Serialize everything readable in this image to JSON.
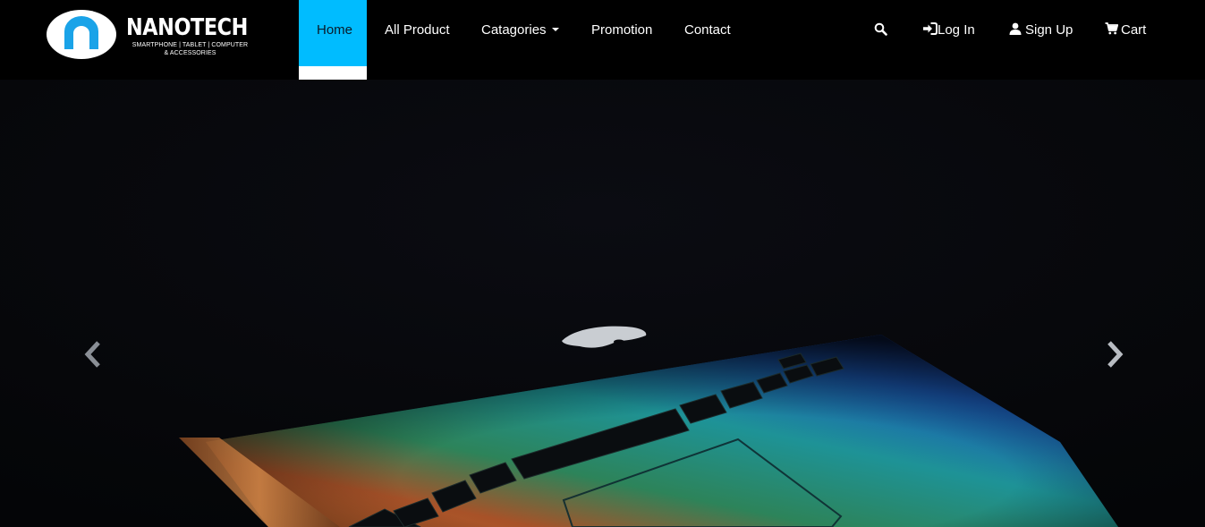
{
  "brand": {
    "name": "NANOTECH",
    "tagline": "SMARTPHONE | TABLET | COMPUTER\n& ACCESSORIES",
    "logo_color": "#1aa3e8"
  },
  "nav": {
    "active_color": "#00bcff",
    "items": [
      {
        "label": "Home",
        "active": true
      },
      {
        "label": "All Product"
      },
      {
        "label": "Catagories",
        "has_dropdown": true
      },
      {
        "label": "Promotion"
      },
      {
        "label": "Contact"
      }
    ],
    "right": {
      "search_icon": "search-icon",
      "login": {
        "icon": "sign-in-icon",
        "label": "Log In"
      },
      "signup": {
        "icon": "user-icon",
        "label": "Sign Up"
      },
      "cart": {
        "icon": "cart-icon",
        "label": "Cart"
      }
    }
  },
  "carousel": {
    "image": "laptop-keyboard-glow",
    "prev_icon": "chevron-left-icon",
    "next_icon": "chevron-right-icon"
  }
}
